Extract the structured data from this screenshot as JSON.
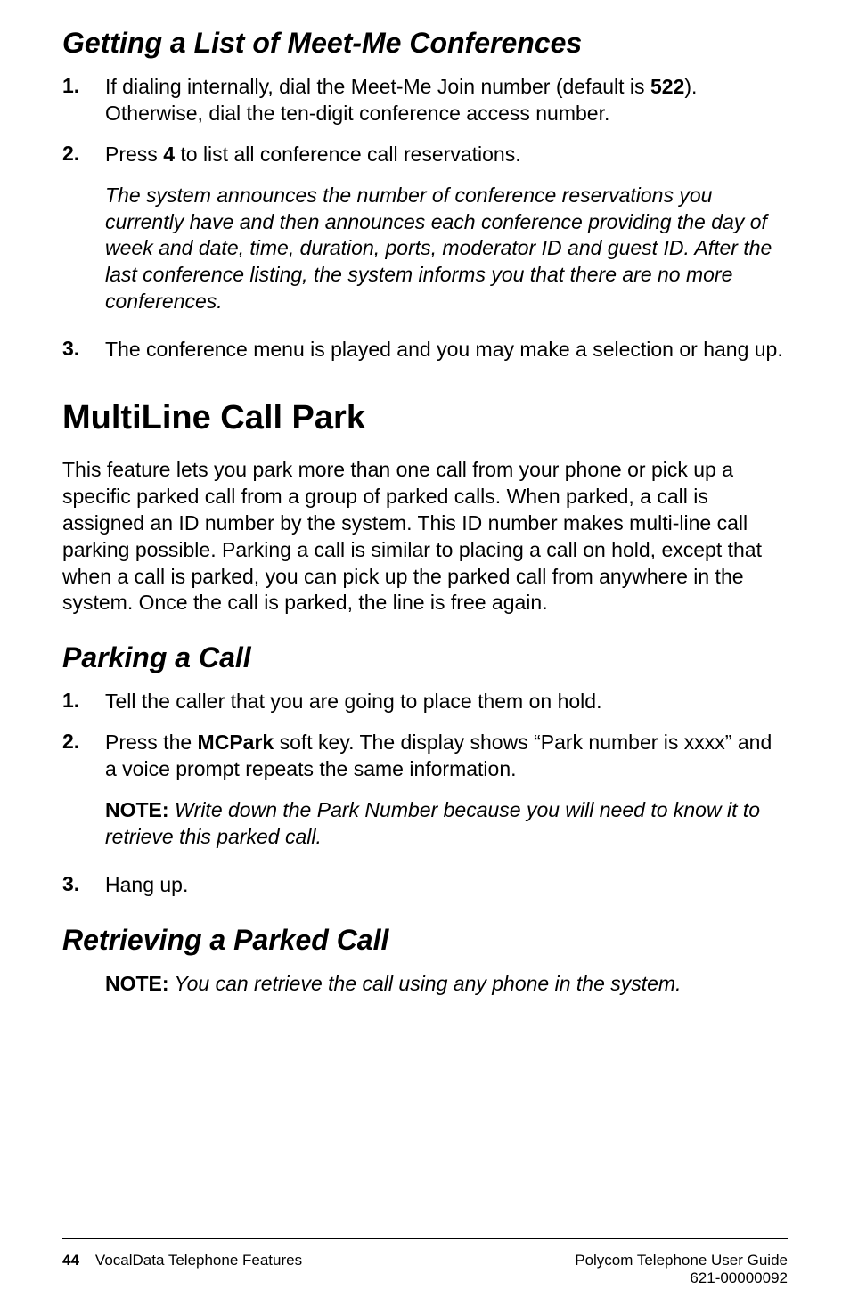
{
  "section1": {
    "heading": "Getting a List of Meet-Me Conferences",
    "items": [
      {
        "num": "1.",
        "text_pre": "If dialing internally, dial the Meet-Me Join number (default is ",
        "bold": "522",
        "text_post": "). Otherwise, dial the ten-digit conference access number."
      },
      {
        "num": "2.",
        "text_pre": "Press ",
        "bold": "4",
        "text_post": " to list all conference call reservations."
      }
    ],
    "italic_block": "The system announces the number of conference reservations you currently have and then announces each conference providing the day of week and date, time, duration, ports, moderator ID and guest ID. After the last conference listing, the system informs you that there are no more conferences.",
    "item3": {
      "num": "3.",
      "text": "The conference menu is played and you may make a selection or hang up."
    }
  },
  "section2": {
    "heading": "MultiLine Call Park",
    "para": "This feature lets you park more than one call from your phone or pick up a specific parked call from a group of parked calls. When parked, a call is assigned an ID number by the system. This ID number makes multi-line call parking possible. Parking a call is similar to placing a call on hold, except that when a call is parked, you can pick up the parked call from anywhere in the system. Once the call is parked, the line is free again."
  },
  "section3": {
    "heading": "Parking a Call",
    "item1": {
      "num": "1.",
      "text": "Tell the caller that you are going to place them on hold."
    },
    "item2": {
      "num": "2.",
      "text_pre": "Press the ",
      "bold": "MCPark",
      "text_post": " soft key. The display shows “Park number is xxxx” and a voice prompt repeats the same information."
    },
    "note_label": "NOTE:",
    "note_text": " Write down the Park Number because you will need to know it to retrieve this parked call.",
    "item3": {
      "num": "3.",
      "text": "Hang up."
    }
  },
  "section4": {
    "heading": "Retrieving a Parked Call",
    "note_label": "NOTE:",
    "note_text": " You can retrieve the call using any phone in the system."
  },
  "footer": {
    "page": "44",
    "left": "VocalData Telephone Features",
    "right_line1": "Polycom Telephone User Guide",
    "right_line2": "621-00000092"
  }
}
